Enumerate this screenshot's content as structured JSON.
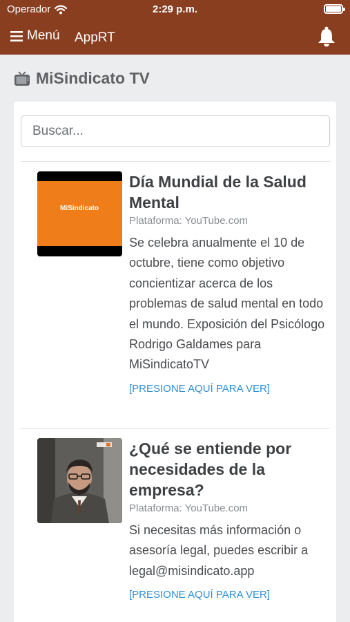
{
  "status_bar": {
    "carrier": "Operador",
    "time": "2:29 p.m."
  },
  "app_bar": {
    "menu_label": "Menú",
    "title": "AppRT"
  },
  "page": {
    "title": "MiSindicato TV"
  },
  "search": {
    "placeholder": "Buscar...",
    "value": ""
  },
  "videos": [
    {
      "title": "Día Mundial de la Salud Mental",
      "platform": "Plataforma: YouTube.com",
      "description": "Se celebra anualmente el 10 de octubre, tiene como objetivo concientizar acerca de los problemas de salud mental en todo el mundo. Exposición del Psicólogo Rodrigo Galdames para MiSindicatoTV",
      "link": "[PRESIONE AQUÍ PARA VER]",
      "thumbnail_text": "MiSindicato"
    },
    {
      "title": "¿Qué se entiende por necesidades de la empresa?",
      "platform": "Plataforma: YouTube.com",
      "description": "Si necesitas más información o asesoría legal, puedes escribir a legal@misindicato.app",
      "link": "[PRESIONE AQUÍ PARA VER]"
    }
  ],
  "colors": {
    "brand": "#8a3e20",
    "link": "#2e8ed8",
    "thumbnail_orange": "#ef7e1a"
  }
}
